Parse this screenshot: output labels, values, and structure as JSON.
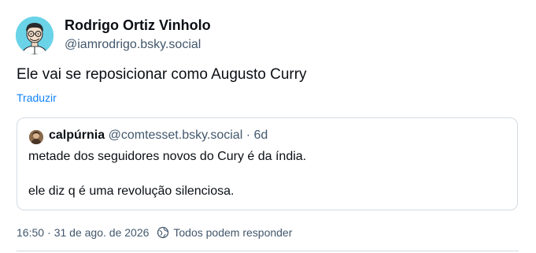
{
  "post": {
    "author": {
      "display_name": "Rodrigo Ortiz Vinholo",
      "handle": "@iamrodrigo.bsky.social",
      "avatar_icon": "cartoon-avatar-icon"
    },
    "text": "Ele vai se reposicionar como Augusto Curry",
    "translate_label": "Traduzir",
    "quoted_post": {
      "author_name": "calpúrnia",
      "author_handle": "@comtesset.bsky.social",
      "separator": " · ",
      "time_ago": "6d",
      "line_1": "metade dos seguidores novos do Cury é da índia.",
      "line_2": "ele diz q é uma revolução silenciosa."
    },
    "footer": {
      "time": "16:50",
      "separator": "·",
      "date": "31 de ago. de 2026",
      "reply_settings_label": "Todos podem responder",
      "reply_settings_icon": "globe-icon"
    }
  },
  "colors": {
    "text_primary": "#0b0f14",
    "text_secondary": "#42576c",
    "link": "#1083fe",
    "border": "#d4dbe2",
    "avatar_bg": "#6ad3e8"
  }
}
